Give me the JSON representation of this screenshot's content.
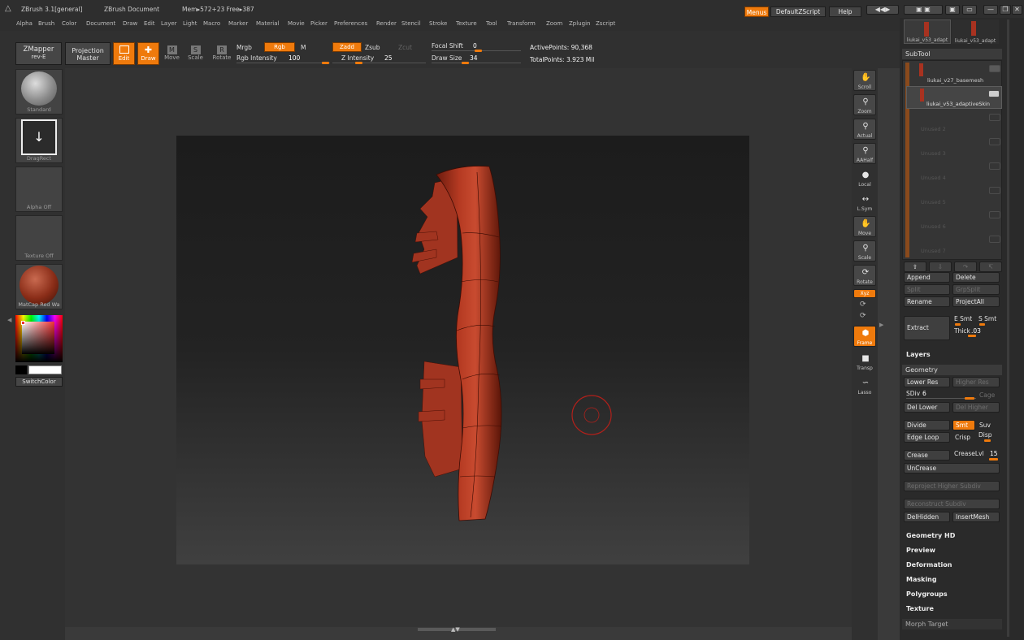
{
  "title_bar": {
    "app": "ZBrush 3.1[general]",
    "document": "ZBrush Document",
    "memory": "Mem▸572+23 Free▸387",
    "menus_button": "Menus",
    "script_button": "DefaultZScript",
    "help_button": "Help"
  },
  "menu_bar": {
    "items": [
      "Alpha",
      "Brush",
      "Color",
      "Document",
      "Draw",
      "Edit",
      "Layer",
      "Light",
      "Macro",
      "Marker",
      "Material",
      "Movie",
      "Picker",
      "Preferences",
      "Render",
      "Stencil",
      "Stroke",
      "Texture",
      "Tool",
      "Transform",
      "Zoom",
      "Zplugin",
      "Zscript"
    ]
  },
  "top_shelf": {
    "zmapper_line1": "ZMapper",
    "zmapper_line2": "rev-E",
    "projection_line1": "Projection",
    "projection_line2": "Master",
    "edit_label": "Edit",
    "draw_label": "Draw",
    "move_label": "Move",
    "scale_label": "Scale",
    "rotate_label": "Rotate",
    "mrgb_label": "Mrgb",
    "rgb_label": "Rgb",
    "m_label": "M",
    "rgb_intensity_label": "Rgb Intensity",
    "rgb_intensity_value": "100",
    "rgb_intensity_fraction": 1.0,
    "zadd_label": "Zadd",
    "zsub_label": "Zsub",
    "zcut_label": "Zcut",
    "z_intensity_label": "Z Intensity",
    "z_intensity_value": "25",
    "z_intensity_fraction": 0.25,
    "focal_shift_label": "Focal Shift",
    "focal_shift_value": "0",
    "focal_shift_fraction": 0.5,
    "draw_size_label": "Draw Size",
    "draw_size_value": "34",
    "draw_size_fraction": 0.3,
    "active_points": "ActivePoints: 90,368",
    "total_points": "TotalPoints: 3.923 Mil"
  },
  "left_shelf": {
    "brush_caption": "Standard",
    "stroke_caption": "DragRect",
    "alpha_caption": "Alpha Off",
    "texture_caption": "Texture Off",
    "material_caption": "MatCap Red Wa",
    "switch_color_label": "SwitchColor"
  },
  "right_shelf": {
    "buttons": [
      "Scroll",
      "Zoom",
      "Actual",
      "AAHalf",
      "Local",
      "L.Sym",
      "Move",
      "Scale",
      "Rotate",
      "Xyz",
      "Frame",
      "Transp",
      "Lasso"
    ]
  },
  "tray": {
    "thumbnails": [
      "liukai_v53_adapt",
      "liukai_v53_adapt"
    ],
    "subtool_header": "SubTool",
    "subtools": [
      "liukai_v27_basemesh",
      "liukai_v53_adaptiveSkin",
      "Unused 2",
      "Unused 3",
      "Unused 4",
      "Unused 5",
      "Unused 6",
      "Unused 7"
    ],
    "append": "Append",
    "delete": "Delete",
    "split": "Split",
    "grpsplit": "GrpSplit",
    "rename": "Rename",
    "projectall": "ProjectAll",
    "extract": "Extract",
    "e_smt": "E Smt",
    "s_smt": "S Smt",
    "thick_label": "Thick",
    "thick_value": ".03",
    "layers": "Layers",
    "geometry_header": "Geometry",
    "lower_res": "Lower Res",
    "higher_res": "Higher Res",
    "sdiv_label": "SDiv",
    "sdiv_value": "6",
    "cage": "Cage",
    "del_lower": "Del Lower",
    "del_higher": "Del Higher",
    "divide": "Divide",
    "smt": "Smt",
    "suv": "Suv",
    "edge_loop": "Edge Loop",
    "crisp": "Crisp",
    "disp": "Disp",
    "crease": "Crease",
    "crease_lvl_label": "CreaseLvl",
    "crease_lvl_value": "15",
    "uncrease": "UnCrease",
    "reproject": "Reproject Higher Subdiv",
    "reconstruct": "Reconstruct Subdiv",
    "delhidden": "DelHidden",
    "insertmesh": "InsertMesh",
    "sections": [
      "Geometry HD",
      "Preview",
      "Deformation",
      "Masking",
      "Polygroups",
      "Texture"
    ],
    "morph_target": "Morph Target"
  },
  "colors": {
    "accent": "#ef7a0c",
    "model": "#a8321f",
    "panel": "#303030"
  }
}
